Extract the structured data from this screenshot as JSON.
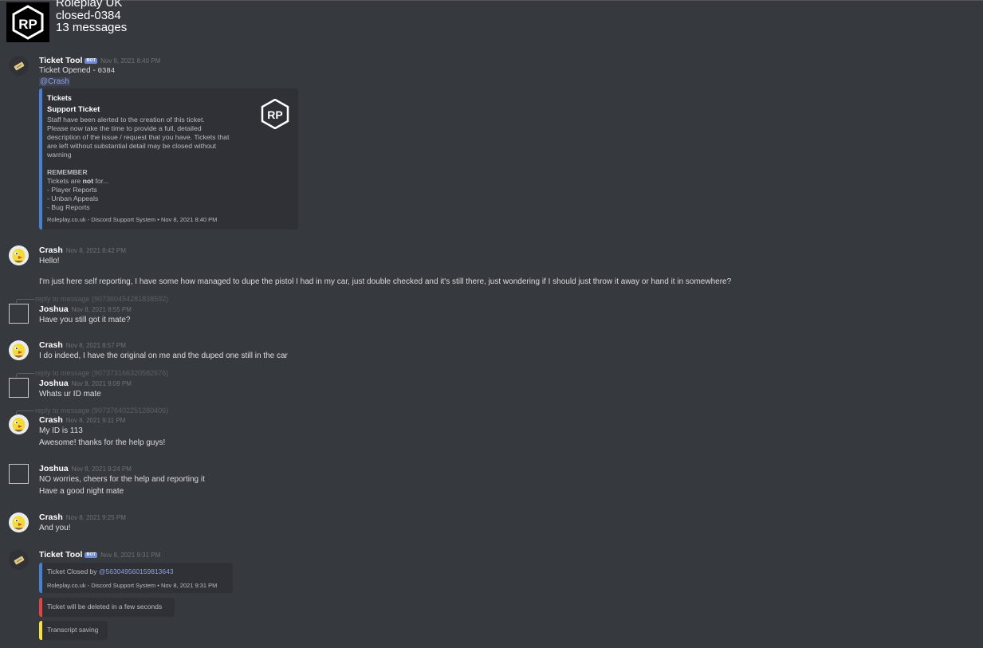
{
  "header": {
    "guild_name": "Roleplay UK",
    "channel_name": "closed-0384",
    "message_count": "13 messages",
    "logo_text": "RP"
  },
  "messages": {
    "m1": {
      "author": "Ticket Tool",
      "bot_tag": "BOT",
      "timestamp": "Nov 8, 2021 8:40 PM",
      "text_prefix": "Ticket Opened - ",
      "code": "0384",
      "mention": "@Crash",
      "embed": {
        "author": "Tickets",
        "title": "Support Ticket",
        "desc_lines": [
          "Staff have been alerted to the creation of this ticket.",
          "Please now take the time to provide a full, detailed",
          "description of the issue / request that you have. Tickets that",
          "are left without substantial detail may be closed without",
          "warning"
        ],
        "remember": "REMEMBER",
        "not_prefix": "Tickets are ",
        "not_word": "not",
        "not_suffix": " for...",
        "list": [
          "- Player Reports",
          "- Unban Appeals",
          "- Bug Reports"
        ],
        "footer": "Roleplay.co.uk - Discord Support System • Nov 8, 2021 8:40 PM",
        "thumb_text": "RP"
      }
    },
    "m2": {
      "author": "Crash",
      "timestamp": "Nov 8, 2021 8:42 PM",
      "lines": [
        "Hello!",
        "I'm just here self reporting, I have some how managed to dupe the pistol I had in my car, just double checked and it's still there, just wondering if I should just throw it away or hand it in somewhere?"
      ]
    },
    "m3": {
      "reply": "reply to message (907360454281838592)",
      "author": "Joshua",
      "timestamp": "Nov 8, 2021 8:55 PM",
      "text": "Have you still got it mate?"
    },
    "m4": {
      "author": "Crash",
      "timestamp": "Nov 8, 2021 8:57 PM",
      "text": "I do indeed, I have the original on me and the duped one still in the car"
    },
    "m5": {
      "reply": "reply to message (907373166320582676)",
      "author": "Joshua",
      "timestamp": "Nov 8, 2021 9:09 PM",
      "text": "Whats ur ID mate"
    },
    "m6": {
      "reply": "reply to message (907376402251280406)",
      "author": "Crash",
      "timestamp": "Nov 8, 2021 9:11 PM",
      "lines": [
        "My ID is 113",
        "Awesome! thanks for the help guys!"
      ]
    },
    "m7": {
      "author": "Joshua",
      "timestamp": "Nov 8, 2021 9:24 PM",
      "lines": [
        "NO worries, cheers for the help and reporting it",
        "Have a good night mate"
      ]
    },
    "m8": {
      "author": "Crash",
      "timestamp": "Nov 8, 2021 9:25 PM",
      "text": "And you!"
    },
    "m9": {
      "author": "Ticket Tool",
      "bot_tag": "BOT",
      "timestamp": "Nov 8, 2021 9:31 PM",
      "embed1_prefix": "Ticket Closed by ",
      "embed1_mention": "@563049560159813643",
      "embed1_footer": "Roleplay.co.uk - Discord Support System • Nov 8, 2021 9:31 PM",
      "embed2_text": "Ticket will be deleted in a few seconds",
      "embed3_text": "Transcript saving"
    }
  },
  "colors": {
    "background": "#36393e",
    "embed_background": "#2f3136",
    "embed_blue": "#4a7fd6",
    "embed_red": "#e04545",
    "embed_yellow": "#f5e142",
    "bot_tag": "#7289da",
    "mention": "#8ea1e1"
  }
}
